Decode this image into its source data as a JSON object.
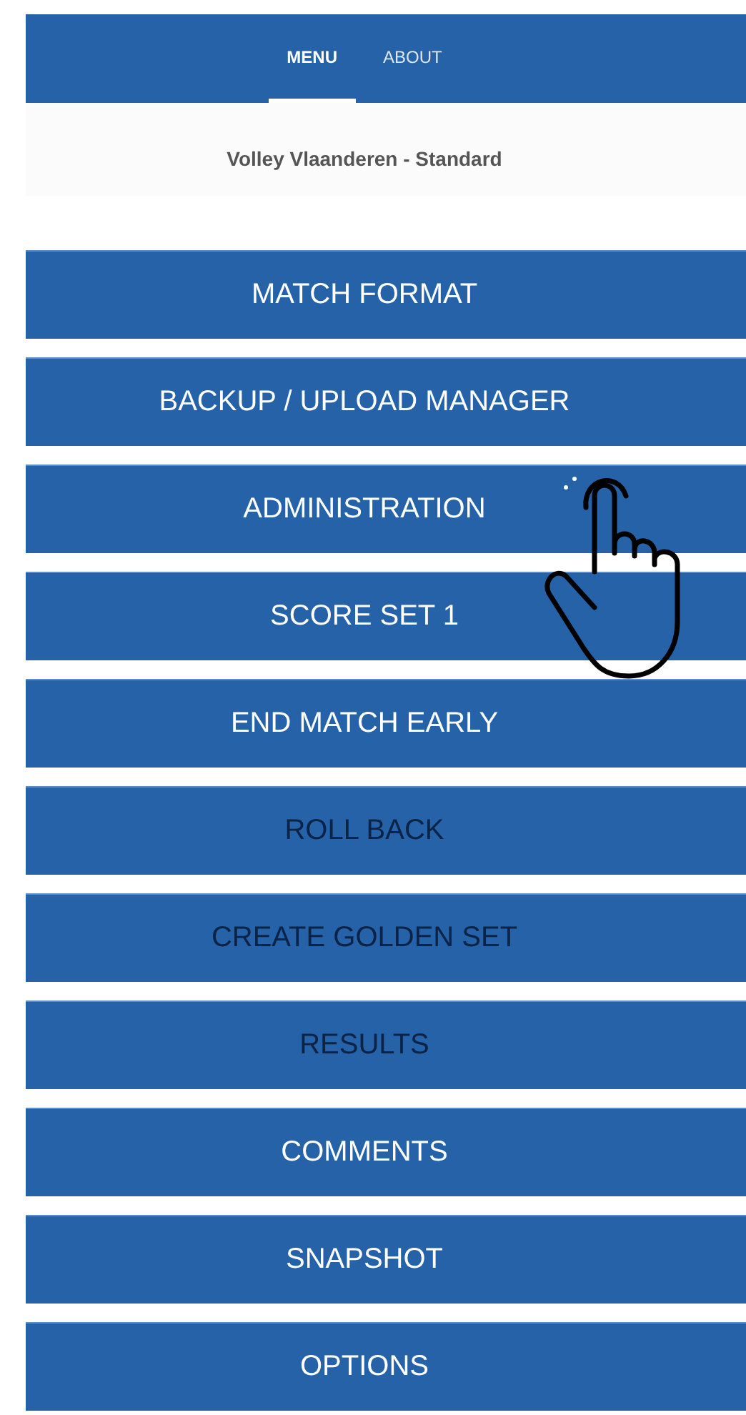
{
  "tabs": [
    {
      "label": "MENU",
      "selected": true
    },
    {
      "label": "ABOUT",
      "selected": false
    }
  ],
  "subtitle": "Volley Vlaanderen - Standard",
  "menu_items": [
    {
      "label": "MATCH FORMAT",
      "disabled": false
    },
    {
      "label": "BACKUP / UPLOAD MANAGER",
      "disabled": false
    },
    {
      "label": "ADMINISTRATION",
      "disabled": false
    },
    {
      "label": "SCORE SET 1",
      "disabled": false
    },
    {
      "label": "END MATCH EARLY",
      "disabled": false
    },
    {
      "label": "ROLL BACK",
      "disabled": true
    },
    {
      "label": "CREATE GOLDEN SET",
      "disabled": true
    },
    {
      "label": "RESULTS",
      "disabled": true
    },
    {
      "label": "COMMENTS",
      "disabled": false
    },
    {
      "label": "SNAPSHOT",
      "disabled": false
    },
    {
      "label": "OPTIONS",
      "disabled": false
    }
  ]
}
